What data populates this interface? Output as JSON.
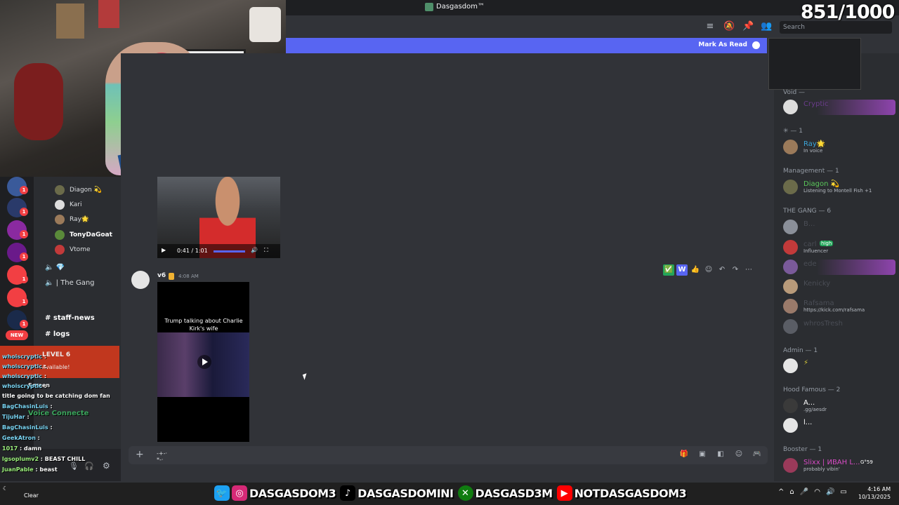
{
  "window": {
    "title": "Dasgasdom™"
  },
  "counter": "851/1000",
  "search": {
    "placeholder": "Search"
  },
  "toolbar": {
    "icons": [
      "threads-icon",
      "mute-icon",
      "pin-icon",
      "members-icon"
    ]
  },
  "banner": {
    "mark_read": "Mark As Read"
  },
  "voice_users": [
    {
      "name": "Diagon 💫",
      "color": "#dbdee1"
    },
    {
      "name": "Kari",
      "color": "#dbdee1"
    },
    {
      "name": "Ray🌟",
      "color": "#dbdee1"
    },
    {
      "name": "TonyDaGoat",
      "color": "#dbdee1"
    },
    {
      "name": "Vtome",
      "color": "#dbdee1"
    }
  ],
  "channels": {
    "voice_gang": "The Gang",
    "staff_news": "staff-news",
    "logs": "logs"
  },
  "video1": {
    "time": "0:41 / 1:01"
  },
  "message2": {
    "author": "v6",
    "time": "4:08 AM",
    "caption": "Trump talking about Charlie Kirk's wife"
  },
  "message_actions": [
    "✅",
    "W",
    "👍",
    "emoji-icon",
    "reply-icon",
    "forward-icon",
    "more-icon"
  ],
  "composer": {
    "text": "-+-·\n*-·"
  },
  "members": {
    "groups": [
      {
        "label": "✳ — 1"
      },
      {
        "label": "Management — 1"
      },
      {
        "label": "THE GANG — 6"
      },
      {
        "label": "Admin — 1"
      },
      {
        "label": "Hood Famous — 2"
      },
      {
        "label": "Booster — 1"
      }
    ],
    "list": [
      {
        "name": "Cryptic",
        "status": "",
        "color": "#6a3c8a"
      },
      {
        "name": "Ray🌟",
        "status": "In voice",
        "color": "#3ba55d"
      },
      {
        "name": "Diagon 💫",
        "status": "Listening to Montell Fish +1",
        "color": "#5ac85a"
      },
      {
        "name": "B...",
        "status": "",
        "color": "#4a4d55"
      },
      {
        "name": "carl",
        "status": "Influencer",
        "color": "#4a4d55"
      },
      {
        "name": "ede",
        "status": "",
        "color": "#4a4d55"
      },
      {
        "name": "Kenicky",
        "status": "",
        "color": "#4a4d55"
      },
      {
        "name": "Rafsama",
        "status": "https://kick.com/rafsama",
        "color": "#4a4d55"
      },
      {
        "name": "whrosTresh",
        "status": "",
        "color": "#4a4d55"
      },
      {
        "name": "",
        "status": "",
        "color": "#4a4d55"
      },
      {
        "name": "A...",
        "status": ".gg/aesdr",
        "color": "#ffffff"
      },
      {
        "name": "l...",
        "status": "",
        "color": "#ffffff"
      },
      {
        "name": "Slixx | ИВАН L...",
        "status": "probably vibin'",
        "color": "#d94cc6"
      }
    ],
    "high_tag": "high",
    "guild_tag": "G°59",
    "void_label": "Void —"
  },
  "overlay": {
    "new": "NEW",
    "lines": [
      {
        "user": "whoiscryptic",
        "msg": ""
      },
      {
        "user": "whoiscryptic",
        "msg": ""
      },
      {
        "user": "whoiscryptic",
        "msg": ""
      },
      {
        "user": "whoiscryptic",
        "msg": ""
      },
      {
        "user": "",
        "msg": "title going to be catching dom fan"
      },
      {
        "user": "BagChasinLuis",
        "msg": ""
      },
      {
        "user": "TijuHar",
        "msg": ""
      },
      {
        "user": "BagChasinLuis",
        "msg": ""
      },
      {
        "user": "GeekAtron",
        "msg": ""
      },
      {
        "user": "1017",
        "msg": "damn"
      },
      {
        "user": "lgsoplumv2",
        "msg": "BEAST CHILL"
      },
      {
        "user": "JuanPable",
        "msg": "beast"
      }
    ],
    "red_box": [
      "LEVEL 6",
      "Available!"
    ],
    "voice_connected": "Voice Connecte",
    "screen": "Screen"
  },
  "socials": [
    {
      "icon": "twitter-icon",
      "handle": "DASGASDOM3",
      "color": "#1da1f2"
    },
    {
      "icon": "instagram-icon",
      "handle": "DASGASDOMINI",
      "color": "#d62976"
    },
    {
      "icon": "tiktok-icon",
      "handle": "DASGASD3M",
      "color": "#000000"
    },
    {
      "icon": "xbox-icon",
      "handle": "NOTDASGASDOM3",
      "color": "#107c10"
    },
    {
      "icon": "youtube-icon",
      "handle": "",
      "color": "#ff0000"
    }
  ],
  "socials_handles": [
    "DASGASDOM3",
    "DASGASDOMINI",
    "DASGASD3M",
    "NOTDASGASDOM3"
  ],
  "taskbar": {
    "weather": "Clear",
    "time": "4:16 AM",
    "date": "10/13/2025"
  }
}
